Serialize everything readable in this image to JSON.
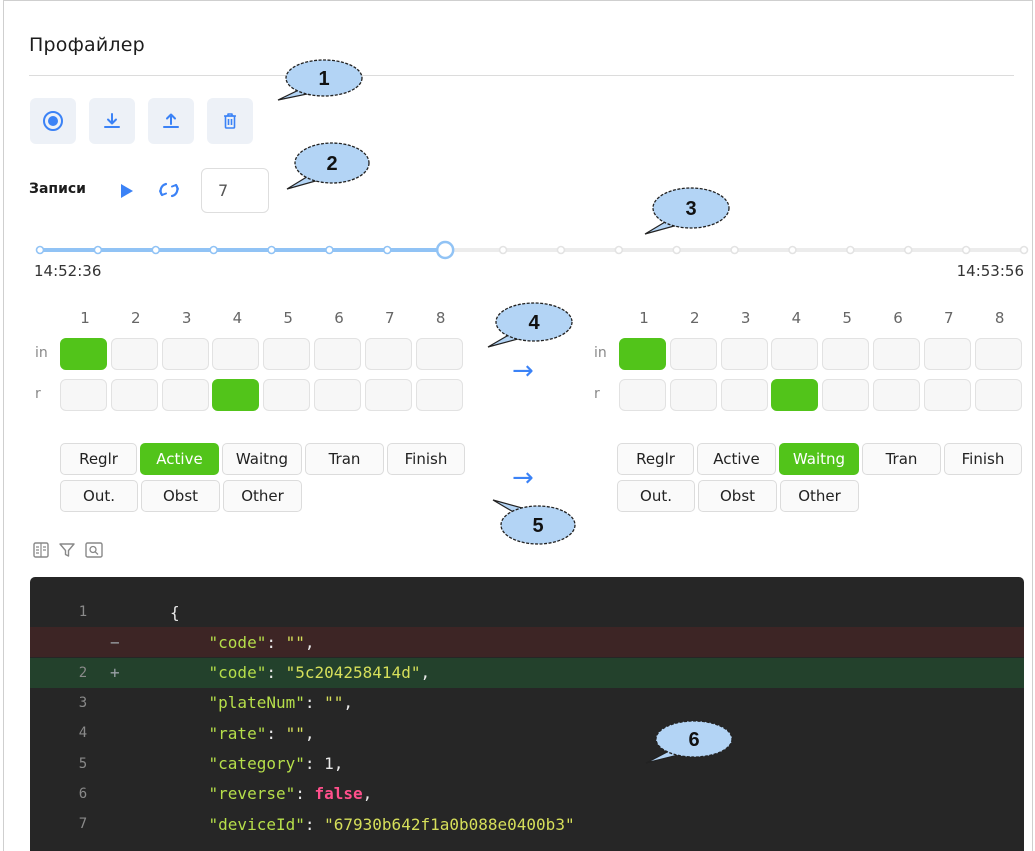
{
  "page": {
    "title": "Профайлер"
  },
  "toolbar": {
    "buttons": [
      "record-icon",
      "download-icon",
      "upload-icon",
      "trash-icon"
    ],
    "accent": "#3b82f6",
    "button_bg": "#edf1f7"
  },
  "records": {
    "label": "Записи",
    "count_value": "7"
  },
  "timeline": {
    "start_time": "14:52:36",
    "end_time": "14:53:56",
    "total_points": 18,
    "filled_points": 8,
    "current_index": 7
  },
  "grid": {
    "columns": [
      "1",
      "2",
      "3",
      "4",
      "5",
      "6",
      "7",
      "8"
    ],
    "rows": [
      "in",
      "r"
    ],
    "before": {
      "in": [
        1
      ],
      "r": [
        4
      ]
    },
    "after": {
      "in": [
        1
      ],
      "r": [
        4
      ]
    }
  },
  "statuses": {
    "labels": [
      "Reglr",
      "Active",
      "Waitng",
      "Tran",
      "Finish",
      "Out.",
      "Obst",
      "Other"
    ],
    "before_active": "Active",
    "after_active": "Waitng"
  },
  "arrow_symbol": "→",
  "callouts": [
    "1",
    "2",
    "3",
    "4",
    "5",
    "6"
  ],
  "code": {
    "lines": [
      {
        "ln": "1",
        "sign": "",
        "type": "ctx",
        "parts": [
          [
            "p",
            "{"
          ]
        ]
      },
      {
        "ln": "",
        "sign": "−",
        "type": "del",
        "parts": [
          [
            "p",
            "    "
          ],
          [
            "k",
            "\"code\""
          ],
          [
            "p",
            ": "
          ],
          [
            "s",
            "\"\""
          ],
          [
            "p",
            ","
          ]
        ]
      },
      {
        "ln": "2",
        "sign": "+",
        "type": "add",
        "parts": [
          [
            "p",
            "    "
          ],
          [
            "k",
            "\"code\""
          ],
          [
            "p",
            ": "
          ],
          [
            "s",
            "\"5c204258414d\""
          ],
          [
            "p",
            ","
          ]
        ]
      },
      {
        "ln": "3",
        "sign": "",
        "type": "ctx",
        "parts": [
          [
            "p",
            "    "
          ],
          [
            "k",
            "\"plateNum\""
          ],
          [
            "p",
            ": "
          ],
          [
            "s",
            "\"\""
          ],
          [
            "p",
            ","
          ]
        ]
      },
      {
        "ln": "4",
        "sign": "",
        "type": "ctx",
        "parts": [
          [
            "p",
            "    "
          ],
          [
            "k",
            "\"rate\""
          ],
          [
            "p",
            ": "
          ],
          [
            "s",
            "\"\""
          ],
          [
            "p",
            ","
          ]
        ]
      },
      {
        "ln": "5",
        "sign": "",
        "type": "ctx",
        "parts": [
          [
            "p",
            "    "
          ],
          [
            "k",
            "\"category\""
          ],
          [
            "p",
            ": "
          ],
          [
            "n",
            "1"
          ],
          [
            "p",
            ","
          ]
        ]
      },
      {
        "ln": "6",
        "sign": "",
        "type": "ctx",
        "parts": [
          [
            "p",
            "    "
          ],
          [
            "k",
            "\"reverse\""
          ],
          [
            "p",
            ": "
          ],
          [
            "b",
            "false"
          ],
          [
            "p",
            ","
          ]
        ]
      },
      {
        "ln": "7",
        "sign": "",
        "type": "ctx",
        "parts": [
          [
            "p",
            "    "
          ],
          [
            "k",
            "\"deviceId\""
          ],
          [
            "p",
            ": "
          ],
          [
            "s",
            "\"67930b642f1a0b088e0400b3\""
          ]
        ]
      }
    ]
  },
  "colors": {
    "green": "#52c41a",
    "code_bg": "#262626",
    "del_bg": "#3d2525",
    "add_bg": "#23412c",
    "bubble": "#b3d4f5"
  }
}
